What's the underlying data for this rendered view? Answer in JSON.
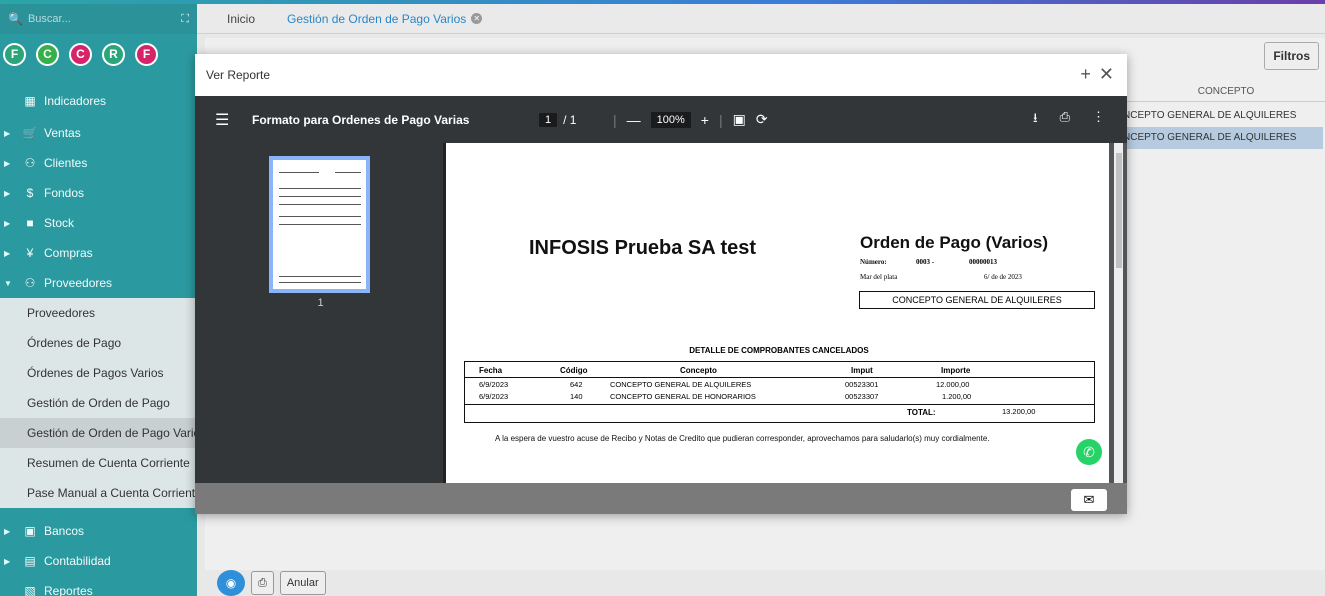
{
  "search": {
    "placeholder": "Buscar..."
  },
  "avatars": [
    {
      "letter": "F",
      "color": "#2aa67a"
    },
    {
      "letter": "C",
      "color": "#35b04a"
    },
    {
      "letter": "C",
      "color": "#d6246b"
    },
    {
      "letter": "R",
      "color": "#2aa67a"
    },
    {
      "letter": "F",
      "color": "#d6246b"
    }
  ],
  "sidebar": {
    "indicadores": "Indicadores",
    "ventas": "Ventas",
    "clientes": "Clientes",
    "fondos": "Fondos",
    "stock": "Stock",
    "compras": "Compras",
    "proveedores": "Proveedores",
    "sub": [
      "Proveedores",
      "Órdenes de Pago",
      "Órdenes de Pagos Varios",
      "Gestión de Orden de Pago",
      "Gestión de Orden de Pago Varios",
      "Resumen de Cuenta Corriente",
      "Pase Manual a Cuenta Corriente"
    ],
    "bancos": "Bancos",
    "contabilidad": "Contabilidad",
    "reportes": "Reportes"
  },
  "tabs": {
    "inicio": "Inicio",
    "active": "Gestión de Orden de Pago Varios"
  },
  "main": {
    "filtros": "Filtros",
    "col_concepto": "CONCEPTO",
    "rows": [
      "NCEPTO GENERAL DE ALQUILERES",
      "NCEPTO GENERAL DE ALQUILERES"
    ]
  },
  "bottom": {
    "anular": "Anular"
  },
  "modal": {
    "title": "Ver Reporte",
    "pdf_title": "Formato para Ordenes de Pago Varias",
    "page_current": "1",
    "page_total": "/ 1",
    "zoom": "100%",
    "thumb_page": "1"
  },
  "report": {
    "company": "INFOSIS Prueba SA test",
    "doc_title": "Orden de Pago (Varios)",
    "numero_label": "Número:",
    "numero_pv": "0003 -",
    "numero_val": "00000013",
    "place": "Mar del plata",
    "date": "6/ de de 2023",
    "concept_box": "CONCEPTO GENERAL DE ALQUILERES",
    "detail_title": "DETALLE DE COMPROBANTES CANCELADOS",
    "headers": {
      "fecha": "Fecha",
      "codigo": "Código",
      "concepto": "Concepto",
      "imput": "Imput",
      "importe": "Importe"
    },
    "rows": [
      {
        "fecha": "6/9/2023",
        "codigo": "642",
        "concepto": "CONCEPTO GENERAL DE ALQUILERES",
        "imput": "00523301",
        "importe": "12.000,00"
      },
      {
        "fecha": "6/9/2023",
        "codigo": "140",
        "concepto": "CONCEPTO GENERAL DE HONORARIOS",
        "imput": "00523307",
        "importe": "1.200,00"
      }
    ],
    "total_label": "TOTAL:",
    "total_value": "13.200,00",
    "footer": "A la espera de vuestro acuse de Recibo y Notas de Credito que pudieran corresponder, aprovechamos para saludarlo(s) muy cordialmente."
  }
}
